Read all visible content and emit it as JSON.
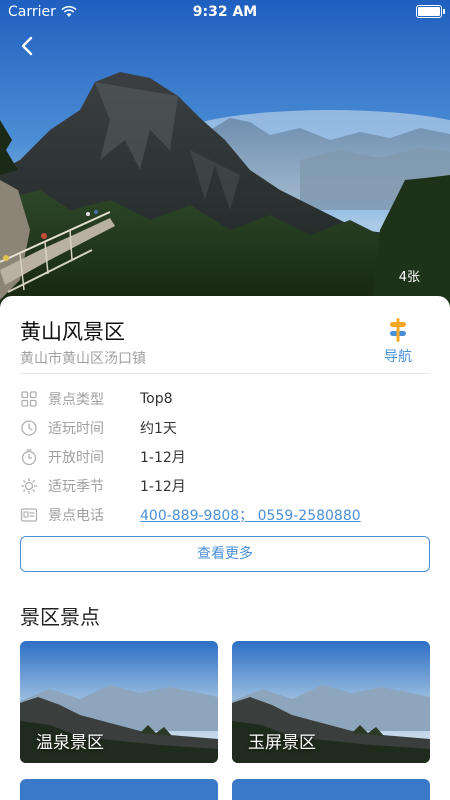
{
  "status_bar": {
    "carrier": "Carrier",
    "time": "9:32 AM"
  },
  "hero": {
    "photo_count": "4张"
  },
  "attraction": {
    "name": "黄山风景区",
    "address": "黄山市黄山区汤口镇",
    "navigate_label": "导航"
  },
  "details": [
    {
      "icon": "grid-icon",
      "label": "景点类型",
      "value": "Top8"
    },
    {
      "icon": "clock-icon",
      "label": "适玩时间",
      "value": "约1天"
    },
    {
      "icon": "timer-icon",
      "label": "开放时间",
      "value": "1-12月"
    },
    {
      "icon": "sun-icon",
      "label": "适玩季节",
      "value": "1-12月"
    },
    {
      "icon": "id-card-icon",
      "label": "景点电话",
      "value": "400-889-9808； 0559-2580880"
    }
  ],
  "more_button": "查看更多",
  "spots_section": {
    "title": "景区景点",
    "items": [
      {
        "name": "温泉景区"
      },
      {
        "name": "玉屏景区"
      }
    ]
  },
  "colors": {
    "accent": "#4a90d9",
    "nav_icon_orange": "#f5a623"
  }
}
